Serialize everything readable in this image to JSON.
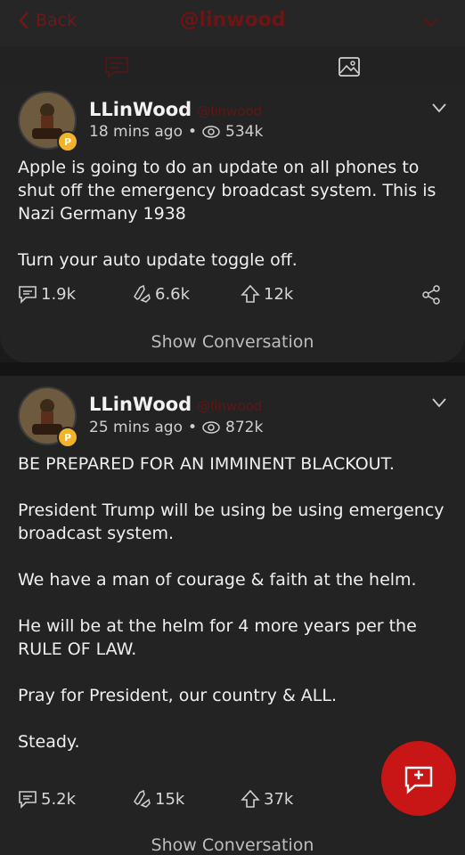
{
  "header": {
    "back_label": "Back",
    "handle": "@linwood"
  },
  "posts": [
    {
      "display_name": "LLinWood",
      "username": "@linwood",
      "time": "18 mins ago",
      "views": "534k",
      "body": "Apple is going to do an update on all phones to shut off the emergency broadcast system. This is Nazi Germany 1938\n\nTurn your auto update toggle off.",
      "comments": "1.9k",
      "reposts": "6.6k",
      "upvotes": "12k",
      "show_conversation": "Show Conversation"
    },
    {
      "display_name": "LLinWood",
      "username": "@linwood",
      "time": "25 mins ago",
      "views": "872k",
      "body": "BE PREPARED FOR AN IMMINENT BLACKOUT.\n\nPresident Trump will be using be using emergency broadcast system.\n\nWe have a man of courage & faith at the helm.\n\nHe will be at the helm for 4 more years per the RULE OF LAW.\n\nPray for President, our country & ALL.\n\nSteady.",
      "comments": "5.2k",
      "reposts": "15k",
      "upvotes": "37k",
      "show_conversation": "Show Conversation"
    }
  ],
  "colors": {
    "accent": "#c81616",
    "background": "#232323",
    "muted_red": "#5e1717"
  },
  "icons": [
    "chevron-left-icon",
    "chevron-down-icon",
    "feed-icon",
    "image-icon",
    "comment-icon",
    "repost-icon",
    "upvote-icon",
    "share-icon",
    "eye-icon",
    "compose-icon"
  ]
}
